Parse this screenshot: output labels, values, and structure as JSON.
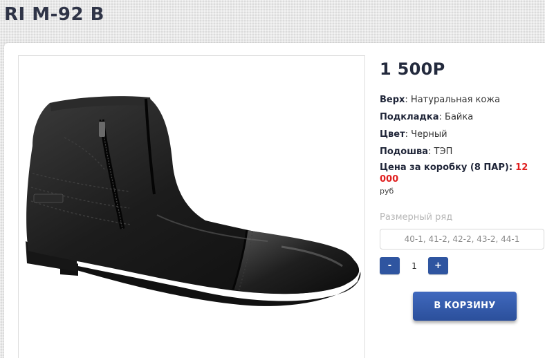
{
  "product": {
    "title": "RI M-92 B",
    "price": "1 500Р",
    "image_alt": "black-leather-ankle-boot"
  },
  "specs": [
    {
      "label": "Верх",
      "value": ": Натуральная кожа"
    },
    {
      "label": "Подкладка",
      "value": ": Байка"
    },
    {
      "label": "Цвет",
      "value": ": Черный"
    },
    {
      "label": "Подошва",
      "value": ": ТЭП"
    }
  ],
  "box_price": {
    "label": "Цена за коробку (8 ПАР):",
    "value": "12 000",
    "currency": "руб"
  },
  "sizes": {
    "label": "Размерный ряд",
    "value": "40-1, 41-2, 42-2, 43-2, 44-1"
  },
  "quantity": {
    "minus_label": "-",
    "plus_label": "+",
    "value": "1"
  },
  "cart_button": {
    "label": "В КОРЗИНУ"
  },
  "colors": {
    "accent": "#2f55a0",
    "price_red": "#e01f1f",
    "title_dark": "#2f3447"
  }
}
